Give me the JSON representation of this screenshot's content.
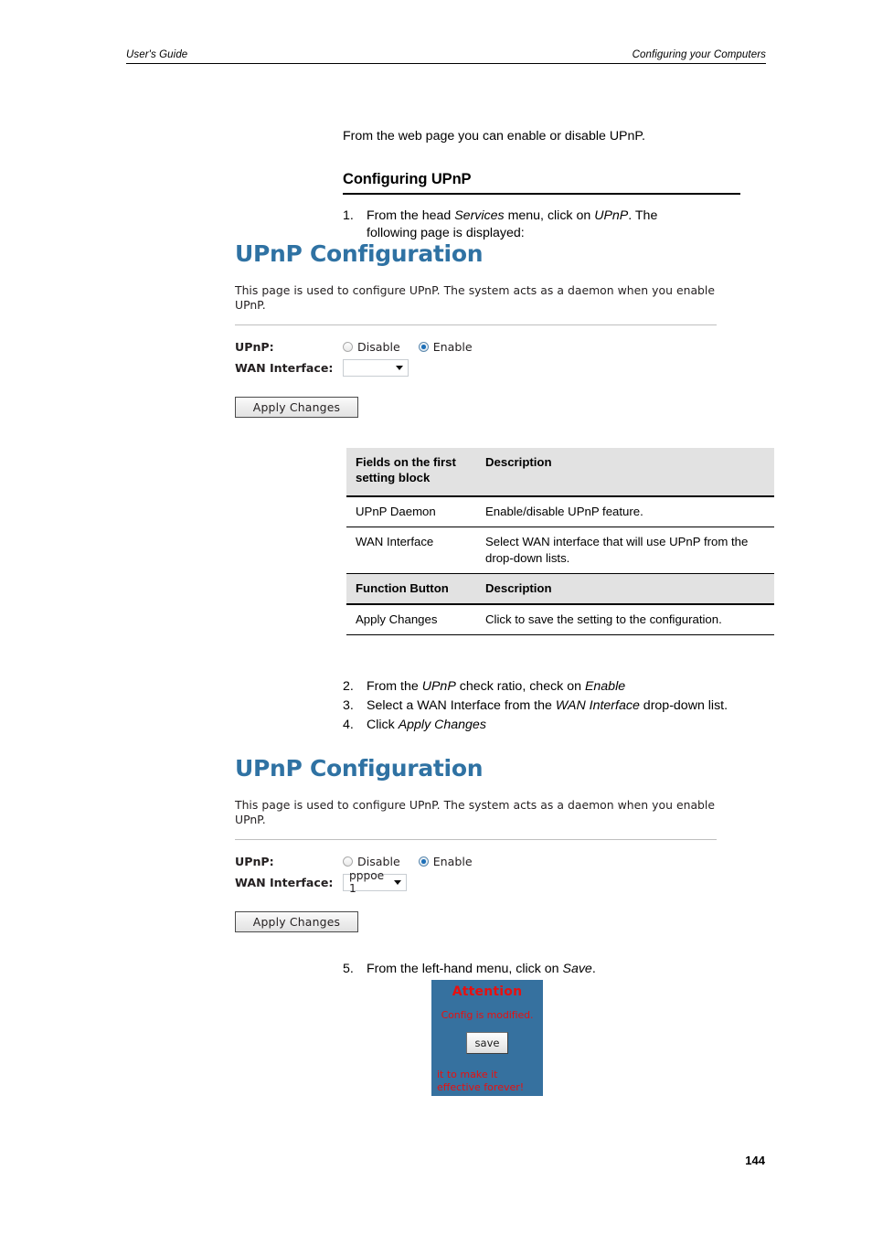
{
  "header": {
    "left": "User's Guide",
    "right": "Configuring your Computers"
  },
  "intro": "From the web page you can enable or disable UPnP.",
  "section_title": "Configuring UPnP",
  "steps": {
    "step1": {
      "num": "1.",
      "part1": "From the head ",
      "em1": "Services",
      "part2": " menu, click on ",
      "em2": "UPnP",
      "part3": ". The following page is displayed:"
    },
    "step2": {
      "num": "2.",
      "part1": "From the ",
      "em1": "UPnP",
      "part2": " check ratio, check on ",
      "em2": "Enable",
      "part3": ""
    },
    "step3": {
      "num": "3.",
      "part1": "Select a WAN Interface from the ",
      "em1": "WAN Interface",
      "part2": " drop-down list.",
      "em2": "",
      "part3": ""
    },
    "step4": {
      "num": "4.",
      "part1": "Click ",
      "em1": "Apply Changes",
      "part2": "",
      "em2": "",
      "part3": ""
    },
    "step5": {
      "num": "5.",
      "part1": "From the left-hand menu, click on ",
      "em1": "Save",
      "part2": ".",
      "em2": "",
      "part3": ""
    }
  },
  "webui": {
    "title": "UPnP Configuration",
    "description": "This page is used to configure UPnP. The system acts as a daemon when you enable UPnP.",
    "upnp_label": "UPnP:",
    "radio_disable": "Disable",
    "radio_enable": "Enable",
    "selected_radio": "Enable",
    "wan_label": "WAN Interface:",
    "wan_value_empty": "",
    "wan_value_filled": "pppoe 1",
    "apply_button": "Apply Changes",
    "accent_color": "#2f72a3"
  },
  "table": {
    "header1": {
      "col1": "Fields on the first setting block",
      "col2": "Description"
    },
    "rows1": [
      {
        "col1": "UPnP Daemon",
        "col2": "Enable/disable UPnP feature."
      },
      {
        "col1": "WAN Interface",
        "col2": "Select WAN interface that will use UPnP from the drop-down lists."
      }
    ],
    "header2": {
      "col1": "Function Button",
      "col2": "Description"
    },
    "rows2": [
      {
        "col1": "Apply Changes",
        "col2": "Click to save the setting to the configuration."
      }
    ]
  },
  "attention": {
    "title": "Attention",
    "line1": "Config is modified.",
    "save_button": "save",
    "footer": "it to make it effective forever!",
    "bg_color": "#36719f",
    "text_color": "#e8100f"
  },
  "page_number": "144"
}
